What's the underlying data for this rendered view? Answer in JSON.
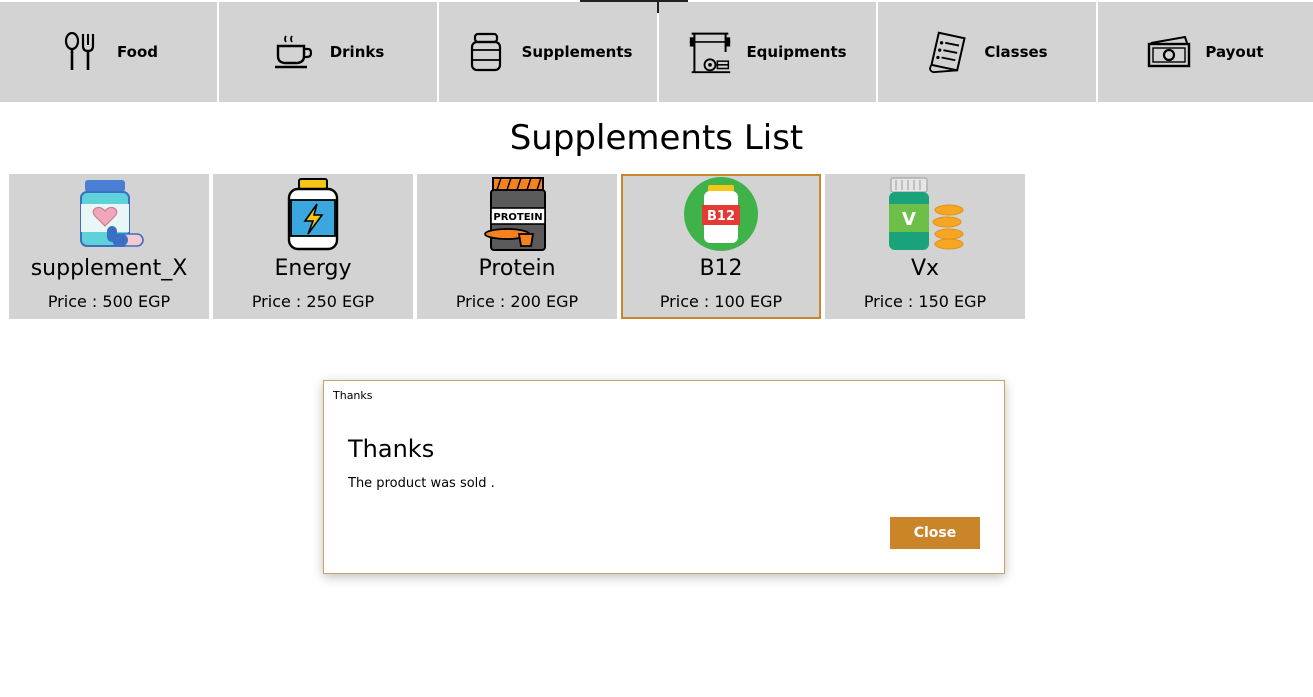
{
  "nav": {
    "items": [
      {
        "label": "Food",
        "icon": "fork-spoon-icon"
      },
      {
        "label": "Drinks",
        "icon": "coffee-cup-icon"
      },
      {
        "label": "Supplements",
        "icon": "supplement-jar-icon"
      },
      {
        "label": "Equipments",
        "icon": "barbell-rack-icon"
      },
      {
        "label": "Classes",
        "icon": "schedule-list-icon"
      },
      {
        "label": "Payout",
        "icon": "cash-icon"
      }
    ]
  },
  "page": {
    "title": "Supplements List"
  },
  "products": [
    {
      "name": "supplement_X",
      "price": "Price : 500 EGP",
      "icon": "pill-bottle-heart-icon",
      "selected": false
    },
    {
      "name": "Energy",
      "price": "Price : 250 EGP",
      "icon": "energy-bottle-icon",
      "selected": false
    },
    {
      "name": "Protein",
      "price": "Price : 200 EGP",
      "icon": "protein-tub-icon",
      "selected": false
    },
    {
      "name": "B12",
      "price": "Price : 100 EGP",
      "icon": "b12-vitamin-icon",
      "selected": true,
      "label_on_image": "B12"
    },
    {
      "name": "Vx",
      "price": "Price : 150 EGP",
      "icon": "vitamin-v-bottle-icon",
      "selected": false,
      "label_on_image": "V"
    }
  ],
  "dialog": {
    "window_title": "Thanks",
    "heading": "Thanks",
    "message": "The product was sold .",
    "close_label": "Close"
  },
  "colors": {
    "nav_bg": "#d3d3d3",
    "card_bg": "#d3d3d3",
    "accent": "#cb8529",
    "selected_border": "#c9862d"
  }
}
